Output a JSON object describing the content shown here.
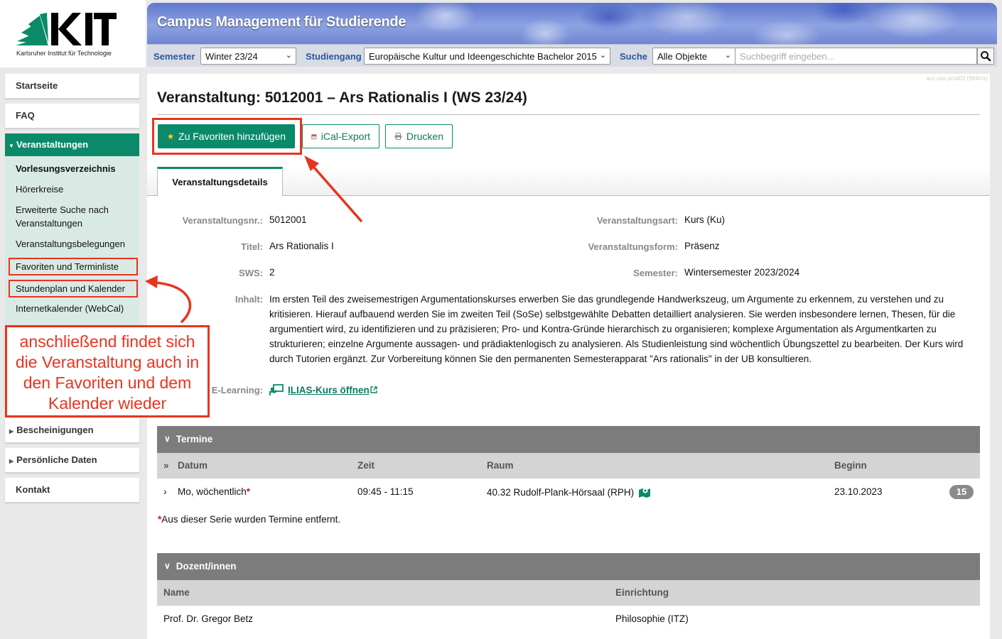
{
  "logo": {
    "wordmark": "KIT",
    "tagline": "Karlsruher Institut für Technologie"
  },
  "header": {
    "title": "Campus Management für Studierende",
    "semester_label": "Semester",
    "semester_value": "Winter 23/24",
    "studiengang_label": "Studiengang",
    "studiengang_value": "Europäische Kultur und Ideengeschichte Bachelor 2015",
    "suche_label": "Suche",
    "suche_scope": "Alle Objekte",
    "search_placeholder": "Suchbegriff eingeben..."
  },
  "server_tag": "acc-cas-prod03 (984ms)",
  "sidebar": {
    "startseite": "Startseite",
    "faq": "FAQ",
    "veranstaltungen": "Veranstaltungen",
    "sub": {
      "vorlesungsverzeichnis": "Vorlesungsverzeichnis",
      "hoererkreise": "Hörerkreise",
      "erweiterte_suche": "Erweiterte Suche nach Veranstaltungen",
      "belegungen": "Veranstaltungsbelegungen",
      "favoriten": "Favoriten und Terminliste",
      "stundenplan": "Stundenplan und Kalender",
      "webcal": "Internetkalender (WebCal)"
    },
    "bescheinigungen": "Bescheinigungen",
    "persoenliche_daten": "Persönliche Daten",
    "kontakt": "Kontakt"
  },
  "page": {
    "title": "Veranstaltung: 5012001 – Ars Rationalis I (WS 23/24)",
    "buttons": {
      "favorite": "Zu Favoriten hinzufügen",
      "ical": "iCal-Export",
      "print": "Drucken"
    },
    "tab": "Veranstaltungsdetails"
  },
  "details": {
    "nr_label": "Veranstaltungsnr.:",
    "nr_value": "5012001",
    "titel_label": "Titel:",
    "titel_value": "Ars Rationalis I",
    "sws_label": "SWS:",
    "sws_value": "2",
    "art_label": "Veranstaltungsart:",
    "art_value": "Kurs (Ku)",
    "form_label": "Veranstaltungsform:",
    "form_value": "Präsenz",
    "semester_label": "Semester:",
    "semester_value": "Wintersemester 2023/2024",
    "inhalt_label": "Inhalt:",
    "inhalt_value": "Im ersten Teil des zweisemestrigen Argumentationskurses erwerben Sie das grundlegende Handwerkszeug, um Argumente zu erkennem, zu verstehen und zu kritisieren. Hierauf aufbauend werden Sie im zweiten Teil (SoSe) selbstgewählte Debatten detailliert analysieren. Sie werden insbesondere lernen, Thesen, für die argumentiert wird, zu identifizieren und zu präzisieren; Pro- und Kontra-Gründe hierarchisch zu organisieren; komplexe Argumentation als Argumentkarten zu strukturieren; einzelne Argumente aussagen- und prädiaktenlogisch zu analysieren. Als Studienleistung sind wöchentlich Übungszettel zu bearbeiten. Der Kurs wird durch Tutorien ergänzt. Zur Vorbereitung können Sie den permanenten Semesterapparat \"Ars rationalis\" in der UB konsultieren.",
    "elearning_label": "E-Learning:",
    "elearning_link": "ILIAS-Kurs öffnen"
  },
  "termine": {
    "heading": "Termine",
    "columns": {
      "datum": "Datum",
      "zeit": "Zeit",
      "raum": "Raum",
      "beginn": "Beginn"
    },
    "row": {
      "datum": "Mo, wöchentlich",
      "zeit": "09:45 - 11:15",
      "raum": "40.32 Rudolf-Plank-Hörsaal (RPH)",
      "beginn": "23.10.2023",
      "count": "15"
    },
    "footnote": "Aus dieser Serie wurden Termine entfernt."
  },
  "dozenten": {
    "heading": "Dozent/innen",
    "columns": {
      "name": "Name",
      "einrichtung": "Einrichtung"
    },
    "row": {
      "name": "Prof. Dr. Gregor Betz",
      "einrichtung": "Philosophie (ITZ)"
    }
  },
  "annotation": {
    "line1": "anschließend findet sich",
    "line2": "die Veranstaltung auch in",
    "line3": "den Favoriten und dem",
    "line4": "Kalender wieder"
  },
  "colors": {
    "accent": "#0b8a6a",
    "annotation": "#e8341f",
    "header_label": "#2b56a3",
    "section_head": "#7c7c7c"
  }
}
